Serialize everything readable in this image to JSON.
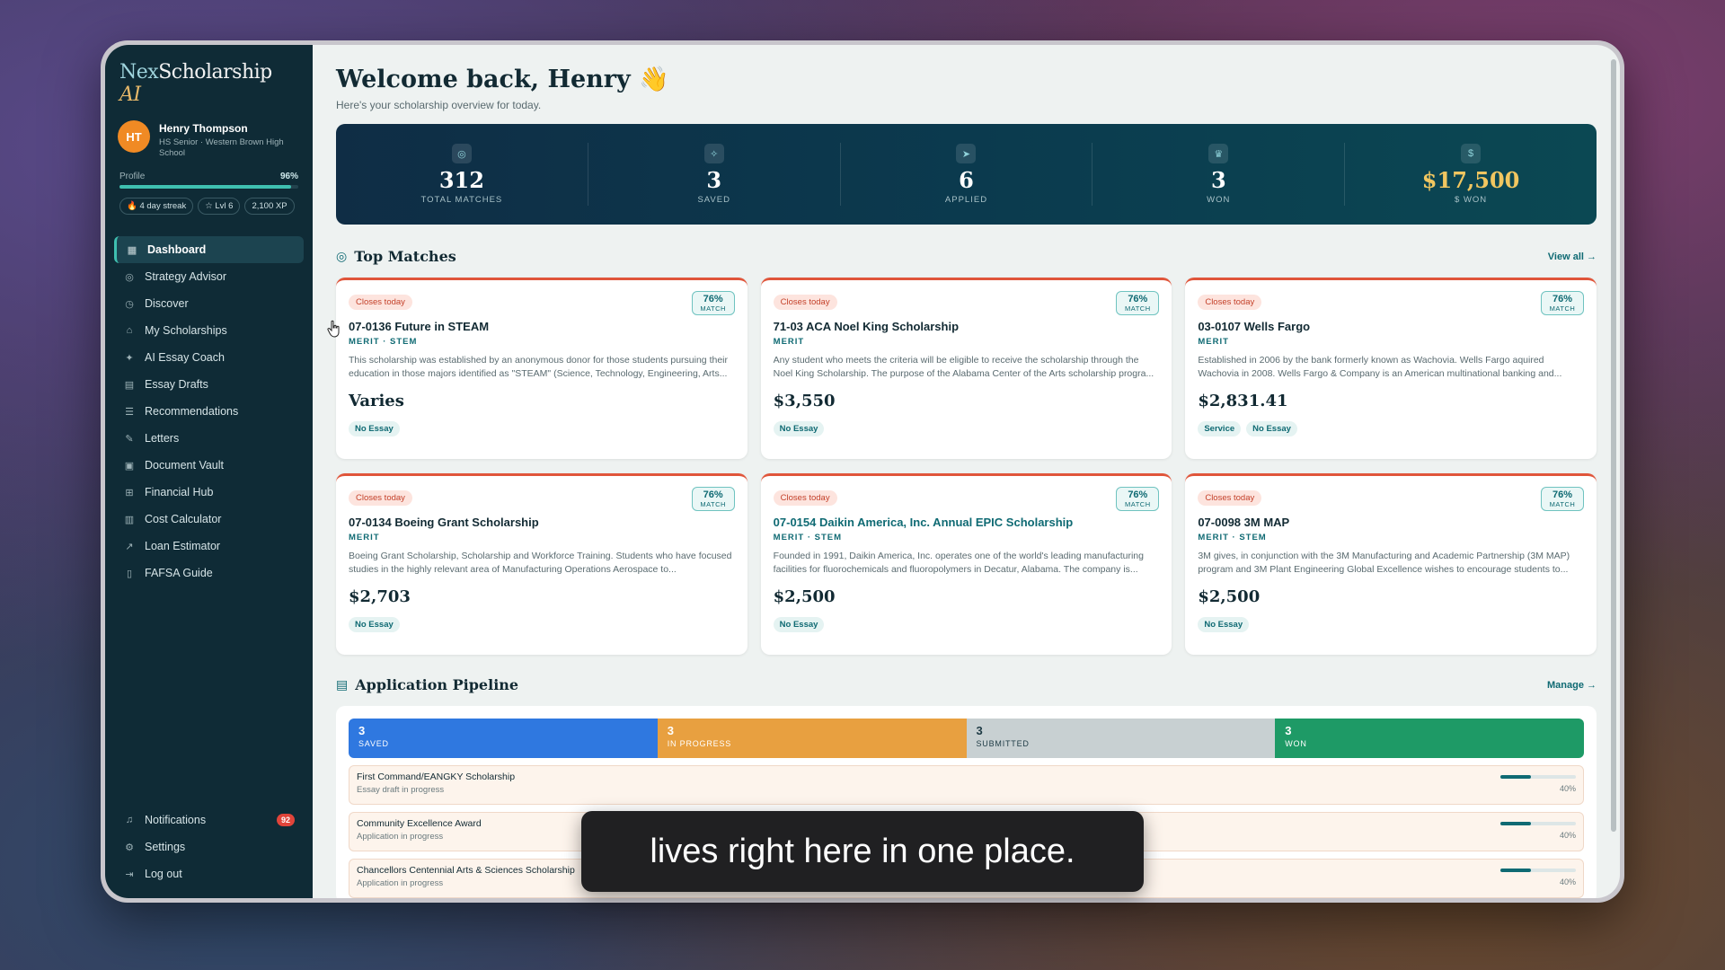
{
  "brand": {
    "prefix": "Nex",
    "name": "Scholarship",
    "suffix": " AI"
  },
  "user": {
    "initials": "HT",
    "name": "Henry Thompson",
    "subtitle": "HS Senior · Western Brown High School"
  },
  "profile": {
    "label": "Profile",
    "pct_label": "96%",
    "pct": 0.96,
    "chips": [
      "4 day streak",
      "Lvl 6",
      "2,100 XP"
    ]
  },
  "nav": {
    "items": [
      {
        "label": "Dashboard",
        "icon": "grid-icon"
      },
      {
        "label": "Strategy Advisor",
        "icon": "target-icon"
      },
      {
        "label": "Discover",
        "icon": "compass-icon"
      },
      {
        "label": "My Scholarships",
        "icon": "cap-icon"
      },
      {
        "label": "AI Essay Coach",
        "icon": "wand-icon"
      },
      {
        "label": "Essay Drafts",
        "icon": "doc-icon"
      },
      {
        "label": "Recommendations",
        "icon": "list-icon"
      },
      {
        "label": "Letters",
        "icon": "pen-icon"
      },
      {
        "label": "Document Vault",
        "icon": "box-icon"
      },
      {
        "label": "Financial Hub",
        "icon": "bank-icon"
      },
      {
        "label": "Cost Calculator",
        "icon": "calc-icon"
      },
      {
        "label": "Loan Estimator",
        "icon": "trend-icon"
      },
      {
        "label": "FAFSA Guide",
        "icon": "book-icon"
      }
    ],
    "bottom": {
      "notifications": "Notifications",
      "notif_count": "92",
      "settings": "Settings",
      "logout": "Log out"
    }
  },
  "header": {
    "title": "Welcome back, Henry 👋",
    "subtitle": "Here's your scholarship overview for today."
  },
  "stats": [
    {
      "value": "312",
      "label": "TOTAL MATCHES",
      "icon": "target-icon"
    },
    {
      "value": "3",
      "label": "SAVED",
      "icon": "pin-icon"
    },
    {
      "value": "6",
      "label": "APPLIED",
      "icon": "send-icon"
    },
    {
      "value": "3",
      "label": "WON",
      "icon": "trophy-icon"
    },
    {
      "value": "$17,500",
      "label": "$ WON",
      "icon": "dollar-icon"
    }
  ],
  "top_matches": {
    "title": "Top Matches",
    "view_all": "View all →"
  },
  "cards": [
    {
      "closes": "Closes today",
      "match": "76%",
      "match_label": "MATCH",
      "title": "07-0136 Future in STEAM",
      "category": "MERIT · STEM",
      "desc": "This scholarship was established by an anonymous donor for those students pursuing their education in those majors identified as \"STEAM\" (Science, Technology, Engineering, Arts...",
      "amount": "Varies",
      "tags": [
        "No Essay"
      ]
    },
    {
      "closes": "Closes today",
      "match": "76%",
      "match_label": "MATCH",
      "title": "71-03 ACA Noel King Scholarship",
      "category": "MERIT",
      "desc": "Any student who meets the criteria will be eligible to receive the scholarship through the Noel King Scholarship. The purpose of the Alabama Center of the Arts scholarship progra...",
      "amount": "$3,550",
      "tags": [
        "No Essay"
      ]
    },
    {
      "closes": "Closes today",
      "match": "76%",
      "match_label": "MATCH",
      "title": "03-0107 Wells Fargo",
      "category": "MERIT",
      "desc": "Established in 2006 by the bank formerly known as Wachovia. Wells Fargo aquired Wachovia in 2008. Wells Fargo & Company is an American multinational banking and...",
      "amount": "$2,831.41",
      "tags": [
        "Service",
        "No Essay"
      ]
    },
    {
      "closes": "Closes today",
      "match": "76%",
      "match_label": "MATCH",
      "title": "07-0134 Boeing Grant Scholarship",
      "category": "MERIT",
      "desc": "Boeing Grant Scholarship, Scholarship and Workforce Training. Students who have focused studies in the highly relevant area of Manufacturing Operations Aerospace to...",
      "amount": "$2,703",
      "tags": [
        "No Essay"
      ]
    },
    {
      "closes": "Closes today",
      "match": "76%",
      "match_label": "MATCH",
      "title": "07-0154 Daikin America, Inc. Annual EPIC Scholarship",
      "category": "MERIT · STEM",
      "desc": "Founded in 1991, Daikin America, Inc. operates one of the world's leading manufacturing facilities for fluorochemicals and fluoropolymers in Decatur, Alabama. The company is...",
      "amount": "$2,500",
      "tags": [
        "No Essay"
      ]
    },
    {
      "closes": "Closes today",
      "match": "76%",
      "match_label": "MATCH",
      "title": "07-0098 3M MAP",
      "category": "MERIT · STEM",
      "desc": "3M gives, in conjunction with the 3M Manufacturing and Academic Partnership (3M MAP) program and 3M Plant Engineering Global Excellence wishes to encourage students to...",
      "amount": "$2,500",
      "tags": [
        "No Essay"
      ]
    }
  ],
  "pipeline": {
    "title": "Application Pipeline",
    "manage": "Manage →",
    "stages": [
      {
        "count": "3",
        "label": "SAVED",
        "color": "#2f78e0"
      },
      {
        "count": "3",
        "label": "IN PROGRESS",
        "color": "#e8a040"
      },
      {
        "count": "3",
        "label": "SUBMITTED",
        "color": "#c8d0d2"
      },
      {
        "count": "3",
        "label": "WON",
        "color": "#1e9a66"
      }
    ],
    "rows": [
      {
        "name": "First Command/EANGKY Scholarship",
        "status": "Essay draft in progress",
        "pct": "40%",
        "progress": 0.4
      },
      {
        "name": "Community Excellence Award",
        "status": "Application in progress",
        "pct": "40%",
        "progress": 0.4
      },
      {
        "name": "Chancellors Centennial Arts & Sciences Scholarship",
        "status": "Application in progress",
        "pct": "40%",
        "progress": 0.4
      }
    ]
  },
  "caption": "lives right here in one place."
}
